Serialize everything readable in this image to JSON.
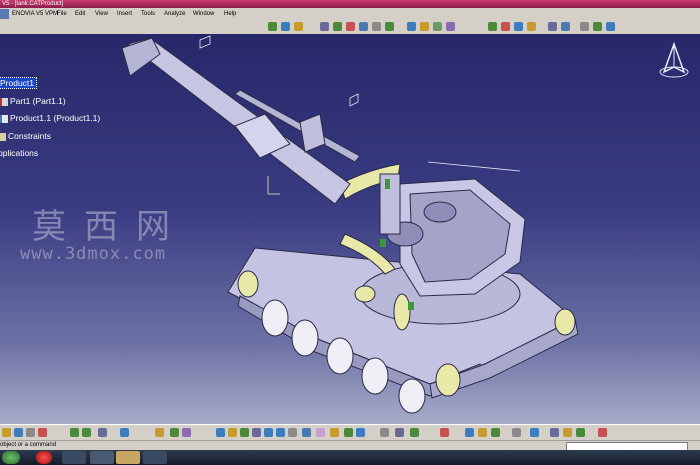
{
  "window": {
    "title": "V5 - [tank.CATProduct]"
  },
  "menu": [
    "ENOVIA V5 VPM",
    "File",
    "Edit",
    "View",
    "Insert",
    "Tools",
    "Analyze",
    "Window",
    "Help"
  ],
  "tree": {
    "root": "Product1",
    "items": [
      "Part1 (Part1.1)",
      "Product1.1 (Product1.1)",
      "Constraints",
      "pplications"
    ]
  },
  "watermark": {
    "cn": "莫西网",
    "url": "www.3dmox.com"
  },
  "status": {
    "message": "object or a command",
    "command_value": ""
  },
  "icons": {
    "compass": "compass-icon",
    "part": "part-icon",
    "product": "product-icon",
    "constraints": "constraints-icon"
  },
  "colors": {
    "viewport_top": "#27286a",
    "viewport_bottom": "#a7acc9",
    "selection": "#1c48c8",
    "tank_body": "#c8c8e4",
    "tank_wheels": "#e8e8a8",
    "titlebar": "#c83a6c"
  }
}
